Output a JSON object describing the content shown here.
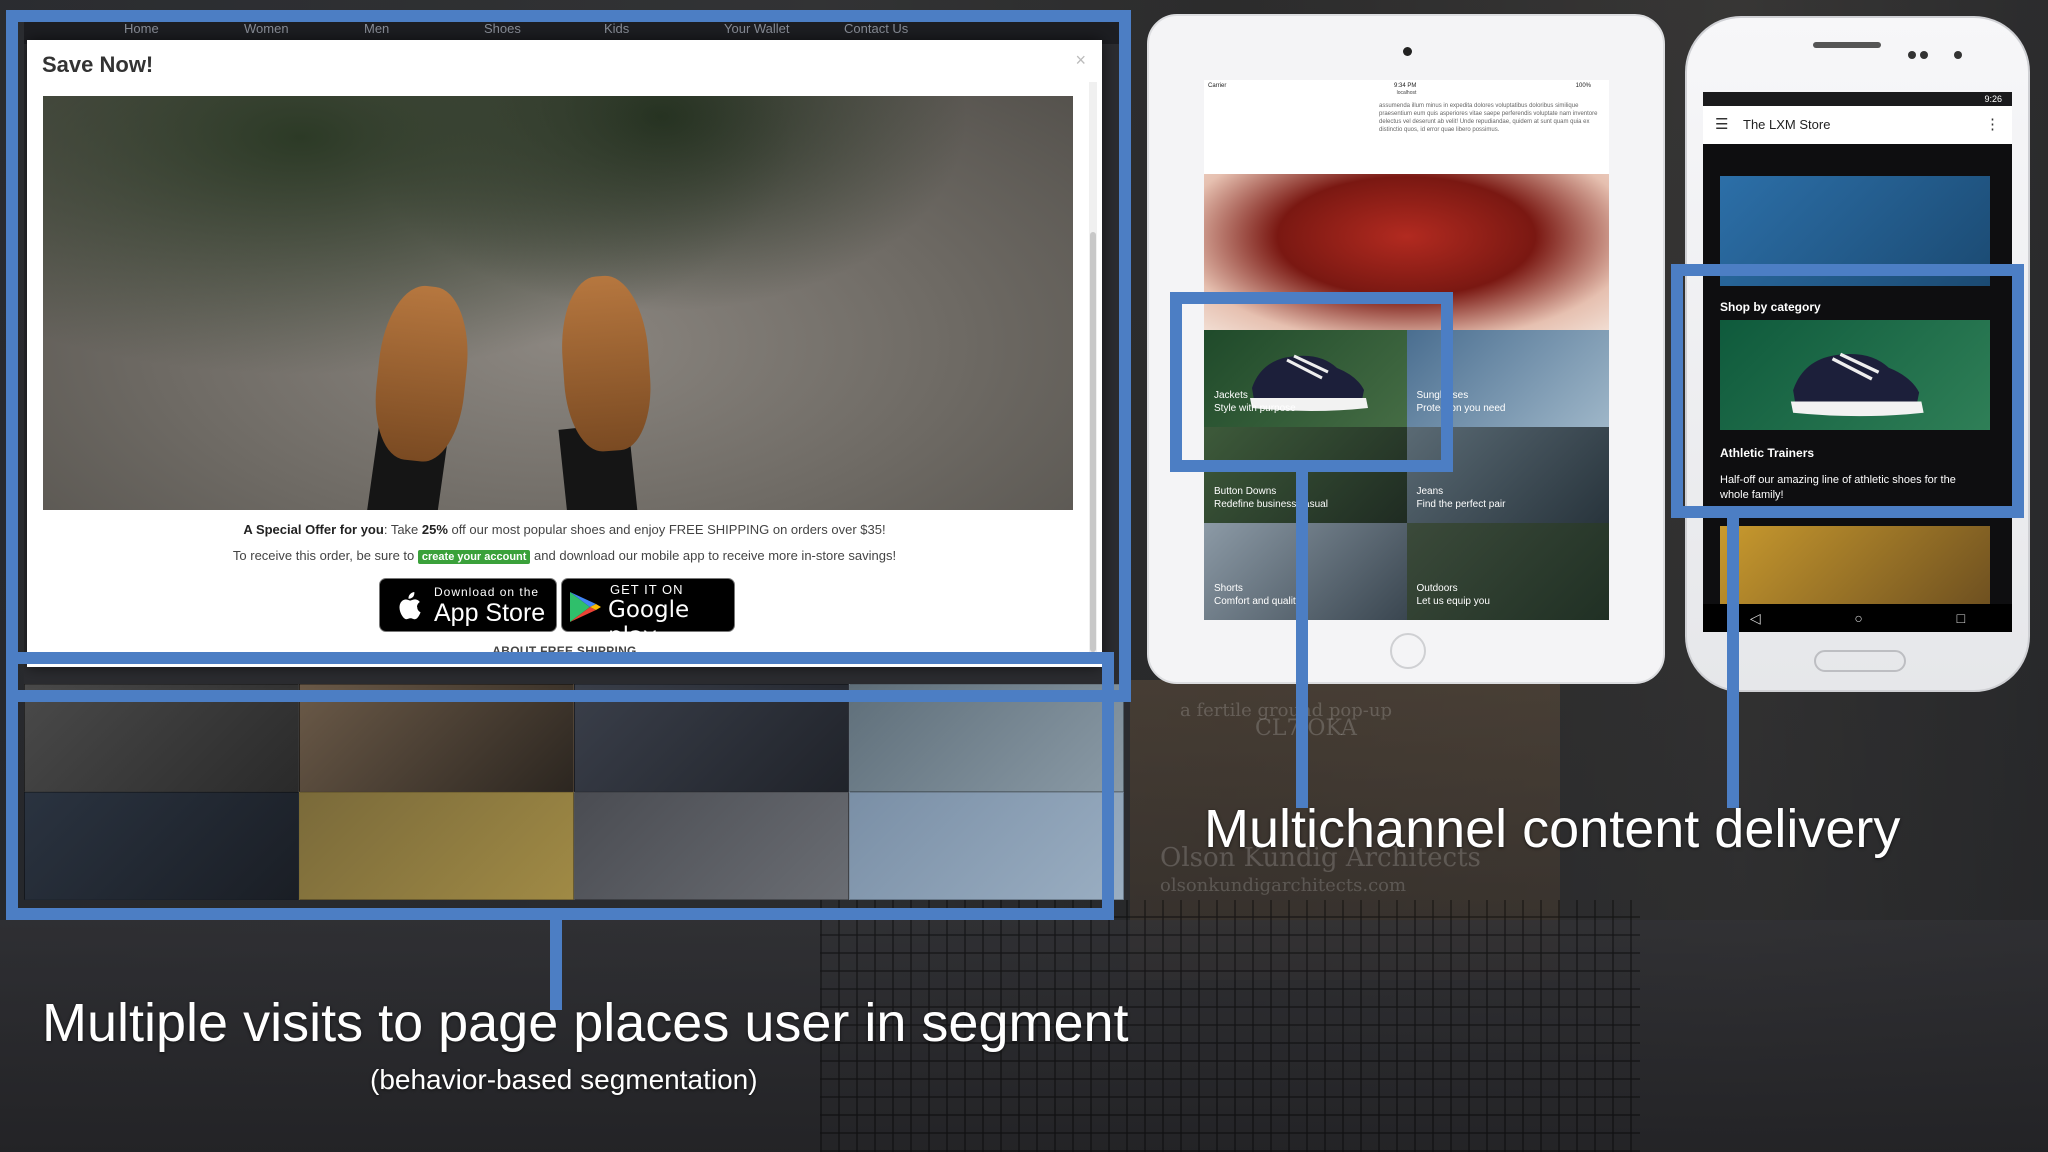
{
  "browser": {
    "nav_items": [
      "Home",
      "Women",
      "Men",
      "Shoes",
      "Kids",
      "Your Wallet",
      "Contact Us"
    ],
    "modal": {
      "title": "Save Now!",
      "close_glyph": "×",
      "offer_lead": "A Special Offer for you",
      "offer_colon": ":",
      "offer_take": " Take ",
      "offer_percent": "25%",
      "offer_rest": " off our most popular shoes and enjoy FREE SHIPPING on orders over $35!",
      "receive_before": "To receive this order, be sure to ",
      "receive_link": "create your account",
      "receive_after": " and download our mobile app to receive more in-store savings!",
      "appstore_small": "Download on the",
      "appstore_big": "App Store",
      "google_small": "GET IT ON",
      "google_big": "Google play",
      "about_link": "ABOUT FREE SHIPPING"
    }
  },
  "tablet": {
    "status_carrier": "Carrier",
    "status_time": "9:34 PM",
    "status_battery": "100%",
    "url": "localhost",
    "lorem": "assumenda illum minus in expedita dolores voluptatibus doloribus similique praesentium eum quis asperiores vitae saepe perferendis voluptate nam inventore delectus vel deserunt ab velit! Unde repudiandae, quidem at sunt quam quia ex distinctio quos, id error quae libero possimus.",
    "tiles": [
      {
        "title": "Jackets",
        "subtitle": "Style with purpose"
      },
      {
        "title": "Sunglasses",
        "subtitle": "Protection you need"
      },
      {
        "title": "Button Downs",
        "subtitle": "Redefine business casual"
      },
      {
        "title": "Jeans",
        "subtitle": "Find the perfect pair"
      },
      {
        "title": "Shorts",
        "subtitle": "Comfort and quality"
      },
      {
        "title": "Outdoors",
        "subtitle": "Let us equip you"
      }
    ]
  },
  "phone": {
    "status_time": "9:26",
    "store_title": "The LXM Store",
    "category_heading": "Shop by category",
    "product_name": "Athletic Trainers",
    "product_desc": "Half-off our amazing line of athletic shoes for the whole family!",
    "nav_back": "◁",
    "nav_home": "○",
    "nav_recent": "□"
  },
  "captions": {
    "multichannel": "Multichannel content delivery",
    "segment": "Multiple visits to page places user in segment",
    "segment_sub": "(behavior-based segmentation)"
  },
  "background": {
    "sign_line1": "a fertile ground pop-up",
    "sign_line2": "CL7 OKA",
    "sign_line3": "Olson Kundig Architects",
    "sign_line4": "olsonkundigarchitects.com"
  },
  "colors": {
    "highlight": "#4c7ec4",
    "cta_green": "#3aa13a"
  },
  "icons": {
    "apple": "apple-icon",
    "google_play": "google-play-icon",
    "hamburger": "hamburger-menu-icon",
    "overflow": "overflow-menu-icon",
    "close": "close-icon"
  }
}
